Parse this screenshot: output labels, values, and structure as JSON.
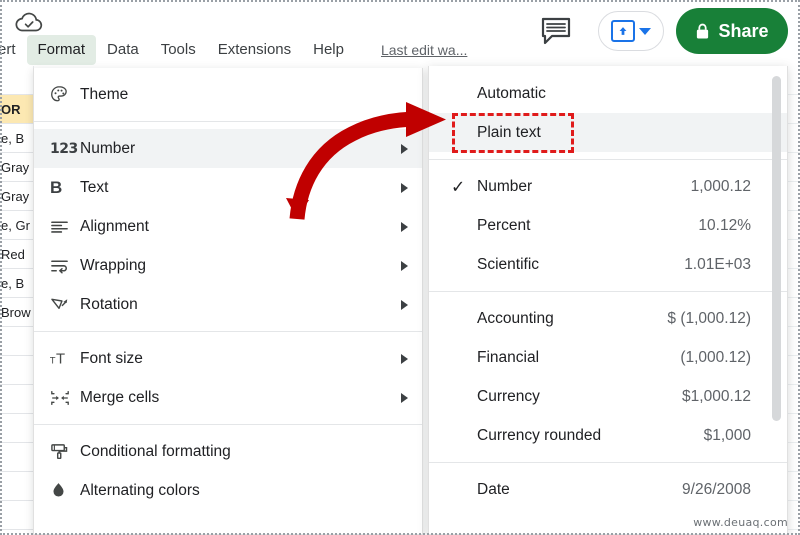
{
  "app": {
    "saved_icon": "cloud-check-icon"
  },
  "menubar": {
    "items": [
      {
        "label": "ert",
        "active": false,
        "clipped": true
      },
      {
        "label": "Format",
        "active": true,
        "clipped": false
      },
      {
        "label": "Data",
        "active": false,
        "clipped": false
      },
      {
        "label": "Tools",
        "active": false,
        "clipped": false
      },
      {
        "label": "Extensions",
        "active": false,
        "clipped": false
      },
      {
        "label": "Help",
        "active": false,
        "clipped": false
      }
    ],
    "last_edit": "Last edit wa..."
  },
  "toolbar_right": {
    "comment_icon": "comment-icon",
    "present_icon": "present-upload-icon",
    "present_caret": "caret-down-icon",
    "share_label": "Share",
    "share_lock_icon": "lock-icon",
    "share_color": "#188038",
    "accent_blue": "#1a73e8"
  },
  "sheet": {
    "left_cells": [
      {
        "text": "",
        "header": false
      },
      {
        "text": "OR",
        "header": true
      },
      {
        "text": "e, B",
        "header": false
      },
      {
        "text": "Gray",
        "header": false
      },
      {
        "text": "Gray",
        "header": false
      },
      {
        "text": "e, Gr",
        "header": false
      },
      {
        "text": " Red",
        "header": false
      },
      {
        "text": "e, B",
        "header": false
      },
      {
        "text": "Brow",
        "header": false
      },
      {
        "text": "",
        "header": false
      },
      {
        "text": "",
        "header": false
      },
      {
        "text": "",
        "header": false
      },
      {
        "text": "",
        "header": false
      },
      {
        "text": "",
        "header": false
      },
      {
        "text": "",
        "header": false
      },
      {
        "text": "",
        "header": false
      }
    ]
  },
  "format_menu": {
    "groups": [
      {
        "items": [
          {
            "label": "Theme",
            "icon": "palette-icon",
            "submenu": false,
            "highlighted": false
          }
        ]
      },
      {
        "items": [
          {
            "label": "Number",
            "icon": "number-123-icon",
            "submenu": true,
            "highlighted": true
          },
          {
            "label": "Text",
            "icon": "bold-b-icon",
            "submenu": true,
            "highlighted": false
          },
          {
            "label": "Alignment",
            "icon": "align-left-icon",
            "submenu": true,
            "highlighted": false
          },
          {
            "label": "Wrapping",
            "icon": "text-wrap-icon",
            "submenu": true,
            "highlighted": false
          },
          {
            "label": "Rotation",
            "icon": "text-rotation-icon",
            "submenu": true,
            "highlighted": false
          }
        ]
      },
      {
        "items": [
          {
            "label": "Font size",
            "icon": "font-size-icon",
            "submenu": true,
            "highlighted": false
          },
          {
            "label": "Merge cells",
            "icon": "merge-cells-icon",
            "submenu": true,
            "highlighted": false
          }
        ]
      },
      {
        "items": [
          {
            "label": "Conditional formatting",
            "icon": "paint-roller-icon",
            "submenu": false,
            "highlighted": false
          },
          {
            "label": "Alternating colors",
            "icon": "water-drop-icon",
            "submenu": false,
            "highlighted": false
          }
        ]
      }
    ]
  },
  "number_submenu": {
    "groups": [
      {
        "items": [
          {
            "label": "Automatic",
            "value": "",
            "checked": false,
            "highlighted": false
          },
          {
            "label": "Plain text",
            "value": "",
            "checked": false,
            "highlighted": true
          }
        ]
      },
      {
        "items": [
          {
            "label": "Number",
            "value": "1,000.12",
            "checked": true,
            "highlighted": false
          },
          {
            "label": "Percent",
            "value": "10.12%",
            "checked": false,
            "highlighted": false
          },
          {
            "label": "Scientific",
            "value": "1.01E+03",
            "checked": false,
            "highlighted": false
          }
        ]
      },
      {
        "items": [
          {
            "label": "Accounting",
            "value": "$ (1,000.12)",
            "checked": false,
            "highlighted": false
          },
          {
            "label": "Financial",
            "value": "(1,000.12)",
            "checked": false,
            "highlighted": false
          },
          {
            "label": "Currency",
            "value": "$1,000.12",
            "checked": false,
            "highlighted": false
          },
          {
            "label": "Currency rounded",
            "value": "$1,000",
            "checked": false,
            "highlighted": false
          }
        ]
      },
      {
        "items": [
          {
            "label": "Date",
            "value": "9/26/2008",
            "checked": false,
            "highlighted": false
          }
        ]
      }
    ]
  },
  "annotations": {
    "arrow_icon": "curved-red-arrow",
    "arrow_color": "#c00000",
    "highlight_box_color": "#e01b1b",
    "highlight_target": "Plain text"
  },
  "watermark": {
    "text": "www.deuaq.com"
  }
}
